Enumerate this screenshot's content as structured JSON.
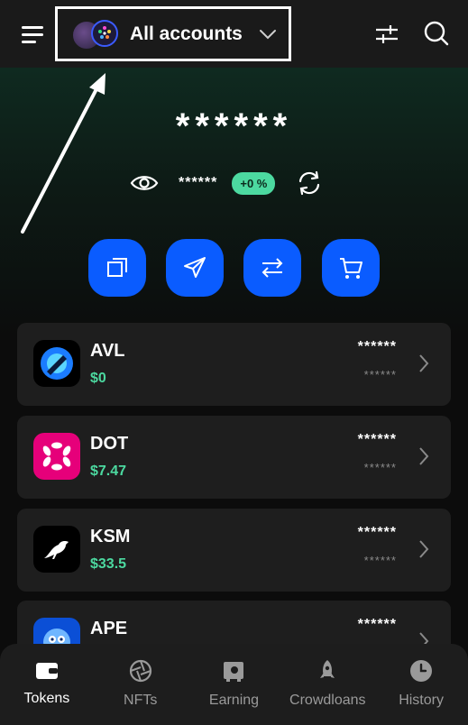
{
  "header": {
    "menu_icon": "hamburger-menu-icon",
    "account_label": "All accounts",
    "filter_icon": "sliders-icon",
    "search_icon": "search-icon"
  },
  "balance": {
    "masked_total": "******",
    "masked_change": "******",
    "change_badge": "+0 %"
  },
  "actions": [
    {
      "icon": "copy-icon",
      "name": "receive"
    },
    {
      "icon": "send-icon",
      "name": "send"
    },
    {
      "icon": "swap-icon",
      "name": "swap"
    },
    {
      "icon": "cart-icon",
      "name": "buy"
    }
  ],
  "tokens": [
    {
      "symbol": "AVL",
      "price": "$0",
      "value": "******",
      "sub_value": "******"
    },
    {
      "symbol": "DOT",
      "price": "$7.47",
      "value": "******",
      "sub_value": "******"
    },
    {
      "symbol": "KSM",
      "price": "$33.5",
      "value": "******",
      "sub_value": "******"
    },
    {
      "symbol": "APE",
      "price": "",
      "value": "******",
      "sub_value": "******"
    }
  ],
  "bottom_nav": [
    {
      "label": "Tokens",
      "icon": "wallet-icon",
      "active": true
    },
    {
      "label": "NFTs",
      "icon": "aperture-icon",
      "active": false
    },
    {
      "label": "Earning",
      "icon": "safe-icon",
      "active": false
    },
    {
      "label": "Crowdloans",
      "icon": "rocket-icon",
      "active": false
    },
    {
      "label": "History",
      "icon": "clock-icon",
      "active": false
    }
  ],
  "colors": {
    "accent": "#0a5cff",
    "positive": "#4cd9a0",
    "card_bg": "#1e1e1e",
    "dot_brand": "#e6007a"
  }
}
